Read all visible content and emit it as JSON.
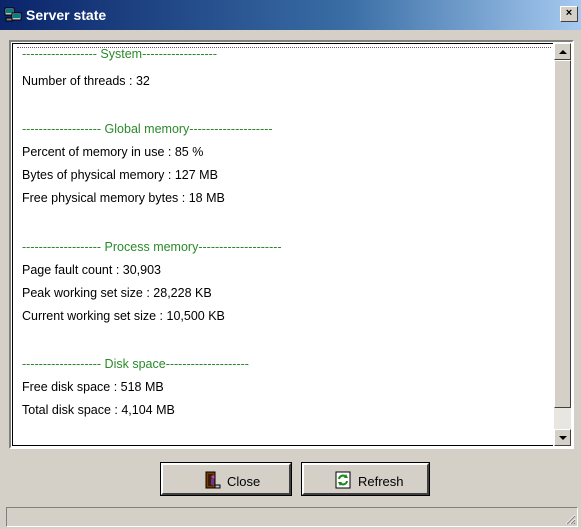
{
  "window": {
    "title": "Server state",
    "close_glyph": "×"
  },
  "sections": [
    {
      "header": "------------------ System------------------",
      "lines": [
        "Number of threads : 32"
      ]
    },
    {
      "header": "------------------- Global memory--------------------",
      "lines": [
        "Percent of memory in use : 85 %",
        "Bytes of physical memory : 127 MB",
        "Free physical memory bytes : 18 MB"
      ]
    },
    {
      "header": "------------------- Process memory--------------------",
      "lines": [
        "Page fault count : 30,903",
        "Peak working set size : 28,228 KB",
        "Current working set size : 10,500 KB"
      ]
    },
    {
      "header": "------------------- Disk space--------------------",
      "lines": [
        "Free disk space : 518 MB",
        "Total disk space : 4,104 MB"
      ]
    }
  ],
  "buttons": {
    "close": "Close",
    "refresh": "Refresh"
  },
  "colors": {
    "section_header": "#2a8a2a",
    "titlebar_start": "#0a246a",
    "background": "#d4d0c8"
  }
}
